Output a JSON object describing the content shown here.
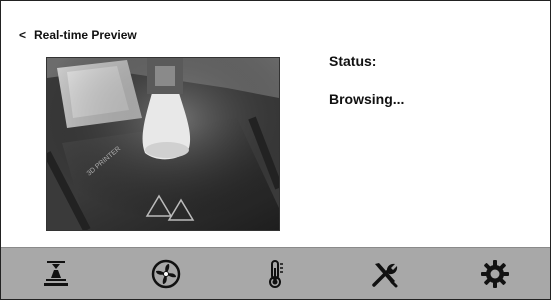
{
  "header": {
    "back_icon": "chevron-left-icon",
    "back_glyph": "<",
    "title": "Real-time Preview"
  },
  "preview": {
    "description_icon": "camera-feed",
    "bed_text": "3D PRINTER"
  },
  "status": {
    "label": "Status:",
    "value": "Browsing..."
  },
  "nav": {
    "items": [
      {
        "icon": "print-bed-icon"
      },
      {
        "icon": "fan-icon"
      },
      {
        "icon": "thermometer-icon"
      },
      {
        "icon": "tools-icon"
      },
      {
        "icon": "settings-gear-icon"
      }
    ]
  },
  "colors": {
    "bar": "#a8a8a8",
    "icon": "#111111"
  }
}
